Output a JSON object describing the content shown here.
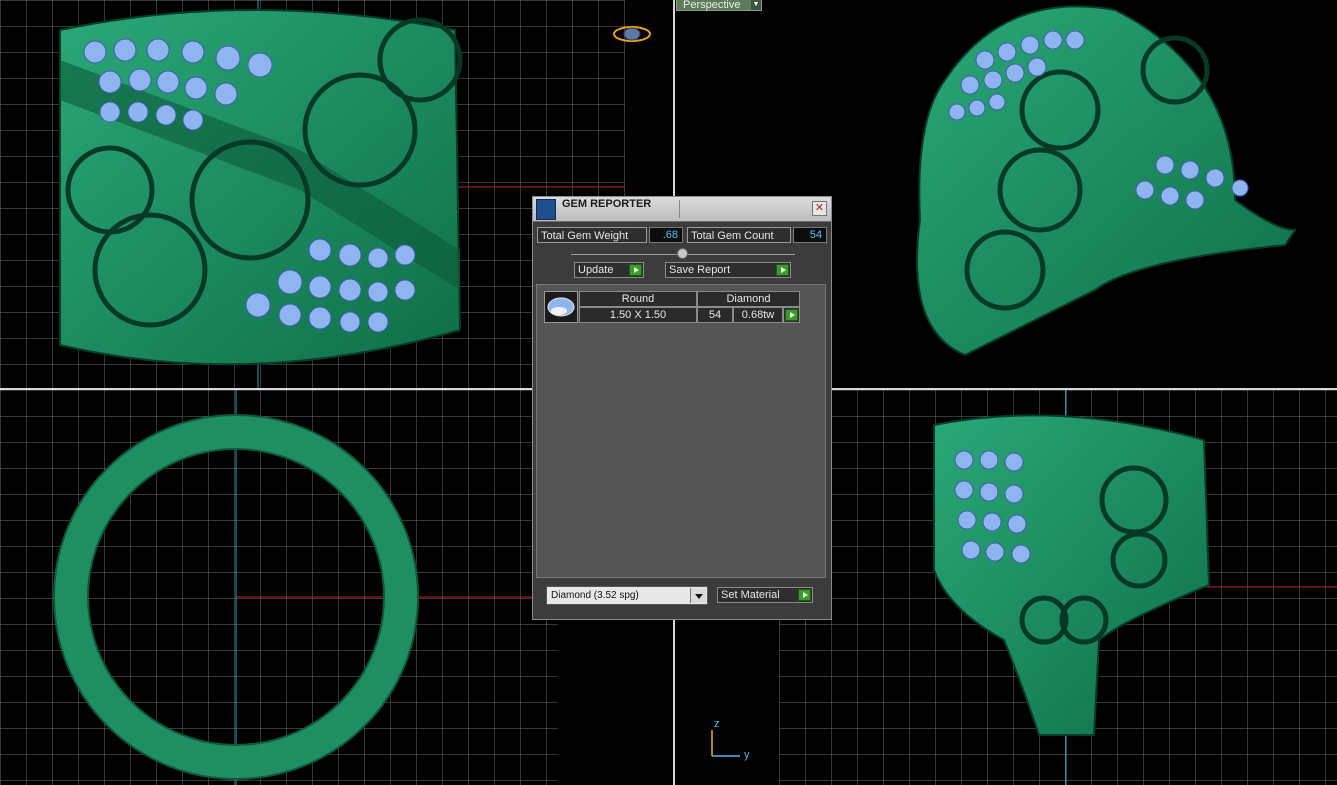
{
  "viewports": {
    "perspective_label": "Perspective",
    "axis_z": "z",
    "axis_y": "y"
  },
  "dialog": {
    "title": "GEM REPORTER",
    "total_gem_weight_label": "Total Gem Weight",
    "total_gem_weight_value": ".68",
    "total_gem_count_label": "Total Gem Count",
    "total_gem_count_value": "54",
    "update_label": "Update",
    "save_report_label": "Save Report",
    "report": {
      "headers": [
        "Round",
        "Diamond"
      ],
      "size": "1.50 X 1.50",
      "count": "54",
      "weight": "0.68tw"
    },
    "material_select": "Diamond     (3.52 spg)",
    "set_material_label": "Set Material"
  },
  "colors": {
    "metal": "#1f8f63",
    "metal_dark": "#0d5a3a",
    "gem": "#8fb4f0",
    "grid": "#7a7a7a",
    "axis_x": "#cc2020",
    "axis_y": "#20a0c0"
  }
}
